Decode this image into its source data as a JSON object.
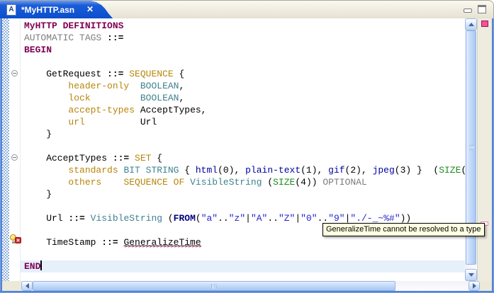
{
  "window": {
    "tab_title": "*MyHTTP.asn",
    "tab_icon_letter": "A",
    "close_glyph": "✕"
  },
  "tooltip": {
    "text": "GeneralizeTime cannot be resolved to a type"
  },
  "colors": {
    "active_tab_blue": "#0b4ecc",
    "tab_bar_beige": "#ece9d8",
    "keyword_maroon": "#7f0055",
    "keyword_orange": "#b8860b",
    "type_teal": "#3f8191",
    "enum_navy": "#0000a0",
    "string_blue": "#2222cc",
    "size_green": "#1e8a1e",
    "modifier_gray": "#7d7d7d",
    "error_squiggle_pink": "#e8308a",
    "tooltip_bg": "#ffffe1",
    "overview_marker_pink": "#fb4f9b",
    "current_line_blue": "#e6f0fb"
  },
  "editor": {
    "lines": [
      {
        "seg": [
          {
            "t": "MyHTTP",
            "s": "kw2"
          },
          {
            "t": " ",
            "s": "pl"
          },
          {
            "t": "DEFINITIONS",
            "s": "kw2"
          }
        ]
      },
      {
        "seg": [
          {
            "t": "AUTOMATIC TAGS ",
            "s": "gy"
          },
          {
            "t": "::=",
            "s": "op"
          }
        ]
      },
      {
        "seg": [
          {
            "t": "BEGIN",
            "s": "kw2"
          }
        ]
      },
      {
        "seg": []
      },
      {
        "fold": true,
        "seg": [
          {
            "t": "    GetRequest ",
            "s": "pl"
          },
          {
            "t": "::=",
            "s": "op"
          },
          {
            "t": " ",
            "s": "pl"
          },
          {
            "t": "SEQUENCE",
            "s": "kw1"
          },
          {
            "t": " {",
            "s": "pl"
          }
        ]
      },
      {
        "seg": [
          {
            "t": "        ",
            "s": "pl"
          },
          {
            "t": "header-only",
            "s": "fd"
          },
          {
            "t": "  ",
            "s": "pl"
          },
          {
            "t": "BOOLEAN",
            "s": "ty"
          },
          {
            "t": ",",
            "s": "pl"
          }
        ]
      },
      {
        "seg": [
          {
            "t": "        ",
            "s": "pl"
          },
          {
            "t": "lock",
            "s": "fd"
          },
          {
            "t": "         ",
            "s": "pl"
          },
          {
            "t": "BOOLEAN",
            "s": "ty"
          },
          {
            "t": ",",
            "s": "pl"
          }
        ]
      },
      {
        "seg": [
          {
            "t": "        ",
            "s": "pl"
          },
          {
            "t": "accept-types",
            "s": "fd"
          },
          {
            "t": " ",
            "s": "pl"
          },
          {
            "t": "AcceptTypes,",
            "s": "pl"
          }
        ]
      },
      {
        "seg": [
          {
            "t": "        ",
            "s": "pl"
          },
          {
            "t": "url",
            "s": "fd"
          },
          {
            "t": "          ",
            "s": "pl"
          },
          {
            "t": "Url",
            "s": "pl"
          }
        ]
      },
      {
        "seg": [
          {
            "t": "    }",
            "s": "pl"
          }
        ]
      },
      {
        "seg": []
      },
      {
        "fold": true,
        "seg": [
          {
            "t": "    AcceptTypes ",
            "s": "pl"
          },
          {
            "t": "::=",
            "s": "op"
          },
          {
            "t": " ",
            "s": "pl"
          },
          {
            "t": "SET",
            "s": "kw1"
          },
          {
            "t": " {",
            "s": "pl"
          }
        ]
      },
      {
        "seg": [
          {
            "t": "        ",
            "s": "pl"
          },
          {
            "t": "standards",
            "s": "fd"
          },
          {
            "t": " ",
            "s": "pl"
          },
          {
            "t": "BIT STRING",
            "s": "ty"
          },
          {
            "t": " { ",
            "s": "pl"
          },
          {
            "t": "html",
            "s": "en"
          },
          {
            "t": "(0), ",
            "s": "pl"
          },
          {
            "t": "plain-text",
            "s": "en"
          },
          {
            "t": "(1), ",
            "s": "pl"
          },
          {
            "t": "gif",
            "s": "en"
          },
          {
            "t": "(2), ",
            "s": "pl"
          },
          {
            "t": "jpeg",
            "s": "en"
          },
          {
            "t": "(3) }  (",
            "s": "pl"
          },
          {
            "t": "SIZE",
            "s": "gr"
          },
          {
            "t": "(",
            "s": "pl"
          }
        ]
      },
      {
        "seg": [
          {
            "t": "        ",
            "s": "pl"
          },
          {
            "t": "others",
            "s": "fd"
          },
          {
            "t": "    ",
            "s": "pl"
          },
          {
            "t": "SEQUENCE OF",
            "s": "kw1"
          },
          {
            "t": " ",
            "s": "pl"
          },
          {
            "t": "VisibleString",
            "s": "ty"
          },
          {
            "t": " (",
            "s": "pl"
          },
          {
            "t": "SIZE",
            "s": "gr"
          },
          {
            "t": "(4)) ",
            "s": "pl"
          },
          {
            "t": "OPTIONAL",
            "s": "gy"
          }
        ]
      },
      {
        "seg": [
          {
            "t": "    }",
            "s": "pl"
          }
        ]
      },
      {
        "seg": []
      },
      {
        "seg": [
          {
            "t": "    Url ",
            "s": "pl"
          },
          {
            "t": "::=",
            "s": "op"
          },
          {
            "t": " ",
            "s": "pl"
          },
          {
            "t": "VisibleString",
            "s": "ty"
          },
          {
            "t": " (",
            "s": "pl"
          },
          {
            "t": "FROM",
            "s": "fr"
          },
          {
            "t": "(",
            "s": "pl"
          },
          {
            "t": "\"a\"",
            "s": "st"
          },
          {
            "t": "..",
            "s": "pl"
          },
          {
            "t": "\"z\"",
            "s": "st"
          },
          {
            "t": "|",
            "s": "pl"
          },
          {
            "t": "\"A\"",
            "s": "st"
          },
          {
            "t": "..",
            "s": "pl"
          },
          {
            "t": "\"Z\"",
            "s": "st"
          },
          {
            "t": "|",
            "s": "pl"
          },
          {
            "t": "\"0\"",
            "s": "st"
          },
          {
            "t": "..",
            "s": "pl"
          },
          {
            "t": "\"9\"",
            "s": "st"
          },
          {
            "t": "|",
            "s": "pl"
          },
          {
            "t": "\"./-_~%#\"",
            "s": "st"
          },
          {
            "t": "))",
            "s": "pl"
          }
        ]
      },
      {
        "seg": []
      },
      {
        "bulb": true,
        "seg": [
          {
            "t": "    TimeStamp ",
            "s": "pl"
          },
          {
            "t": "::=",
            "s": "op"
          },
          {
            "t": " ",
            "s": "pl"
          },
          {
            "t": "GeneralizeTime",
            "s": "er"
          }
        ]
      },
      {
        "seg": []
      },
      {
        "current": true,
        "caret": true,
        "seg": [
          {
            "t": "END",
            "s": "kw2"
          }
        ]
      }
    ]
  }
}
